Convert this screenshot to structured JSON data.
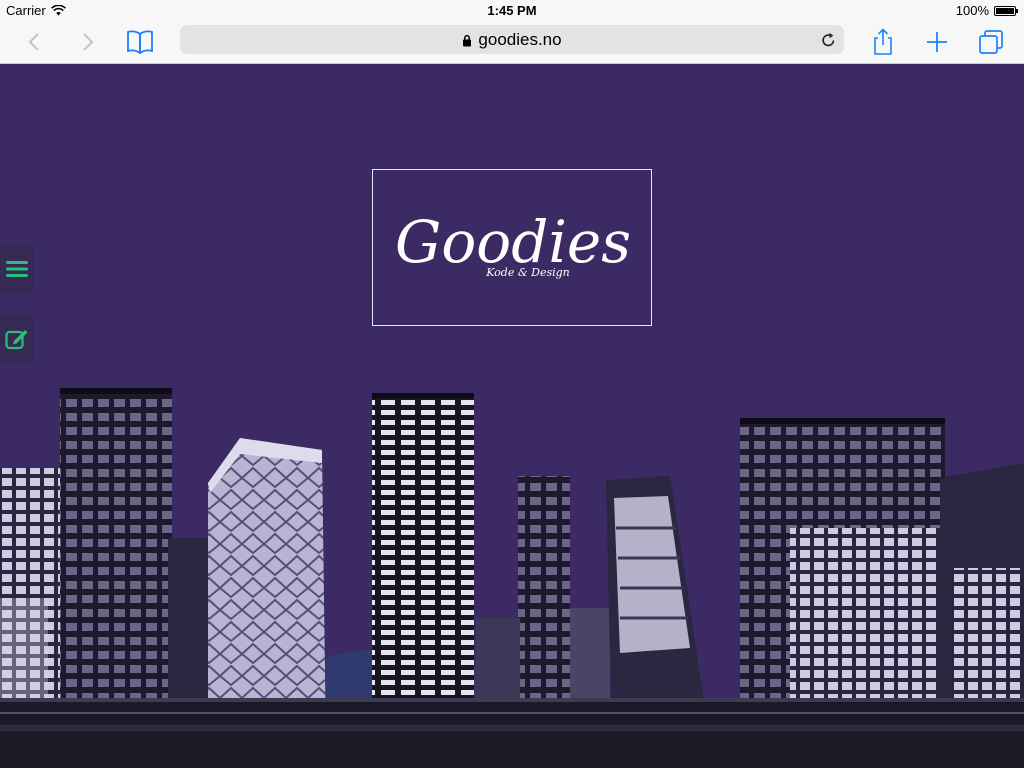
{
  "status_bar": {
    "carrier": "Carrier",
    "time": "1:45 PM",
    "battery": "100%"
  },
  "browser": {
    "url": "goodies.no"
  },
  "site": {
    "logo_title": "Goodies",
    "logo_subtitle": "Kode & Design"
  },
  "side_menu": {
    "icons": [
      "hamburger-menu-icon",
      "edit-icon"
    ],
    "accent_color": "#27c07a"
  },
  "colors": {
    "background": "#3b2a63",
    "toolbar_accent": "#1a82fb"
  }
}
